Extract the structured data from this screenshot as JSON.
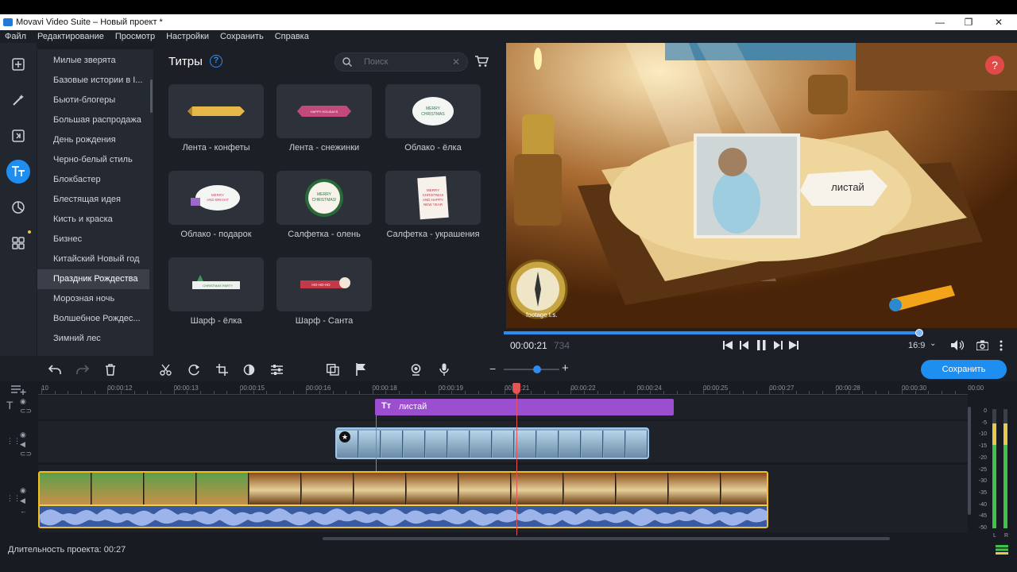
{
  "window": {
    "title": "Movavi Video Suite – Новый проект *",
    "minimize": "—",
    "maximize": "❐",
    "close": "✕"
  },
  "menu": [
    "Файл",
    "Редактирование",
    "Просмотр",
    "Настройки",
    "Сохранить",
    "Справка"
  ],
  "rail_icons": [
    "import-icon",
    "magic-wand-icon",
    "transitions-icon",
    "titles-icon",
    "stickers-icon",
    "more-tools-icon"
  ],
  "categories": [
    "Милые зверята",
    "Базовые истории в I...",
    "Бьюти-блогеры",
    "Большая распродажа",
    "День рождения",
    "Черно-белый стиль",
    "Блокбастер",
    "Блестящая идея",
    "Кисть и краска",
    "Бизнес",
    "Китайский Новый год",
    "Праздник Рождества",
    "Морозная ночь",
    "Волшебное Рождес...",
    "Зимний лес"
  ],
  "selected_category": "Праздник Рождества",
  "panel": {
    "title": "Титры",
    "help": "?",
    "search_placeholder": "Поиск",
    "search_clear": "✕"
  },
  "tiles": [
    {
      "label": "Лента - конфеты",
      "art": "ribbon-gold"
    },
    {
      "label": "Лента - снежинки",
      "art": "ribbon-pink",
      "art_text": "HAPPY HOLIDAYS"
    },
    {
      "label": "Облако - ёлка",
      "art": "cloud",
      "art_text": "MERRY CHRISTMAS"
    },
    {
      "label": "Облако - подарок",
      "art": "cloud-gift",
      "art_text": "MERRY AND BRIGHT"
    },
    {
      "label": "Салфетка - олень",
      "art": "round",
      "art_text": "MERRY CHRISTMAS"
    },
    {
      "label": "Салфетка - украшения",
      "art": "paper",
      "art_text": "MERRY CHRISTMAS AND HAPPY NEW YEAR"
    },
    {
      "label": "Шарф - ёлка",
      "art": "scarf",
      "art_text": "CHRISTMAS PARTY"
    },
    {
      "label": "Шарф - Санта",
      "art": "scarf-red",
      "art_text": "HO-HO-HO"
    }
  ],
  "preview": {
    "overlay_text": "листай",
    "watermark": "footage t.s.",
    "help": "?"
  },
  "player": {
    "time": "00:00:21",
    "frames": "734",
    "aspect": "16:9",
    "progress": 0.81
  },
  "toolbar": {
    "save_label": "Сохранить",
    "zoom_level": 0.6
  },
  "ruler_ticks": [
    "10",
    "00:00:12",
    "00:00:13",
    "00:00:15",
    "00:00:16",
    "00:00:18",
    "00:00:19",
    "00:00:21",
    "00:00:22",
    "00:00:24",
    "00:00:25",
    "00:00:27",
    "00:00:28",
    "00:00:30",
    "00:00"
  ],
  "title_clip": {
    "label": "листай"
  },
  "audio_meter": {
    "scale": [
      "0",
      "-5",
      "-10",
      "-15",
      "-20",
      "-25",
      "-30",
      "-35",
      "-40",
      "-45",
      "-50"
    ],
    "left_label": "L",
    "right_label": "R"
  },
  "status": {
    "duration": "Длительность проекта: 00:27"
  },
  "colors": {
    "accent": "#1e8ef0",
    "title_clip": "#9b4fd0",
    "playhead": "#e25555",
    "clip_border": "#f0c020"
  }
}
